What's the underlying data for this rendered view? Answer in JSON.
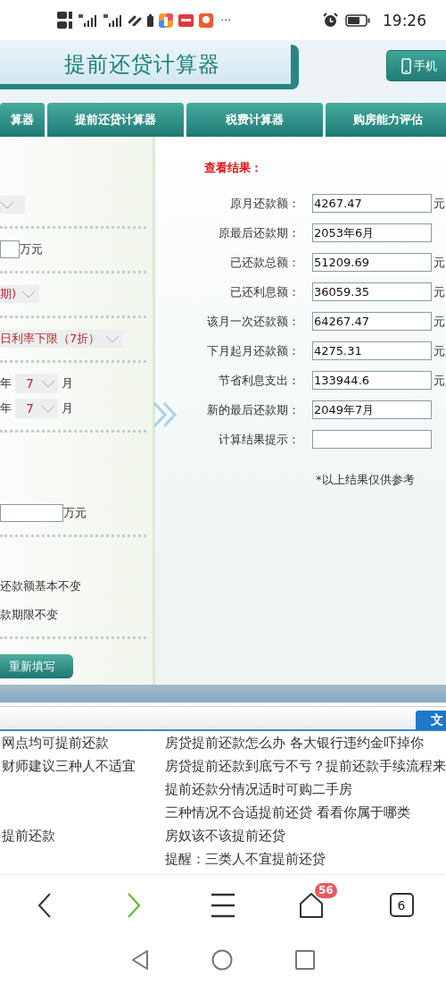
{
  "status_bar": {
    "more": "···",
    "time": "19:26"
  },
  "header": {
    "title": "提前还贷计算器",
    "mobile_button": "手机"
  },
  "nav_tabs": [
    {
      "label": "算器"
    },
    {
      "label": "提前还贷计算器"
    },
    {
      "label": "税费计算器"
    },
    {
      "label": "购房能力评估"
    }
  ],
  "form": {
    "rows": [
      {
        "kind": "select"
      },
      {
        "kind": "divider"
      },
      {
        "kind": "input",
        "unit": "万元"
      },
      {
        "kind": "divider"
      },
      {
        "kind": "select",
        "value": "期)"
      },
      {
        "kind": "divider"
      },
      {
        "kind": "select",
        "value": "日利率下限（7折）"
      },
      {
        "kind": "divider"
      },
      {
        "kind": "date",
        "year_unit": "年",
        "month": "7",
        "month_unit": "月"
      },
      {
        "kind": "date",
        "year_unit": "年",
        "month": "7",
        "month_unit": "月"
      },
      {
        "kind": "divider"
      },
      {
        "kind": "amount",
        "unit": "万元"
      },
      {
        "kind": "divider"
      },
      {
        "kind": "text",
        "text": "还款额基本不变"
      },
      {
        "kind": "text",
        "text": "款期限不变"
      },
      {
        "kind": "divider"
      },
      {
        "kind": "button",
        "label": "重新填写"
      }
    ]
  },
  "results": {
    "heading": "查看结果：",
    "rows": [
      {
        "label": "原月还款额：",
        "value": "4267.47",
        "unit": "元"
      },
      {
        "label": "原最后还款期：",
        "value": "2053年6月"
      },
      {
        "label": "已还款总额：",
        "value": "51209.69",
        "unit": "元"
      },
      {
        "label": "已还利息额：",
        "value": "36059.35",
        "unit": "元"
      },
      {
        "label": "该月一次还款额：",
        "value": "64267.47",
        "unit": "元"
      },
      {
        "label": "下月起月还款额：",
        "value": "4275.31",
        "unit": "元"
      },
      {
        "label": "节省利息支出：",
        "value": "133944.6",
        "unit": "元"
      },
      {
        "label": "新的最后还款期：",
        "value": "2049年7月"
      },
      {
        "label": "计算结果提示："
      }
    ],
    "note": "*以上结果仅供参考"
  },
  "search_bar": {
    "tab": "文"
  },
  "articles": [
    {
      "left": "网点均可提前还款",
      "right": "房贷提前还款怎么办 各大银行违约金吓掉你"
    },
    {
      "left": "财师建议三种人不适宜",
      "right": "房贷提前还款到底亏不亏？提前还款手续流程来"
    },
    {
      "right": "提前还款分情况适时可购二手房"
    },
    {
      "right": "三种情况不合适提前还贷 看看你属于哪类"
    },
    {
      "left": "提前还款",
      "right": "房奴该不该提前还贷"
    },
    {
      "right": "提醒：三类人不宜提前还贷"
    }
  ],
  "browser_bar": {
    "badge": "56",
    "tab_count": "6"
  }
}
